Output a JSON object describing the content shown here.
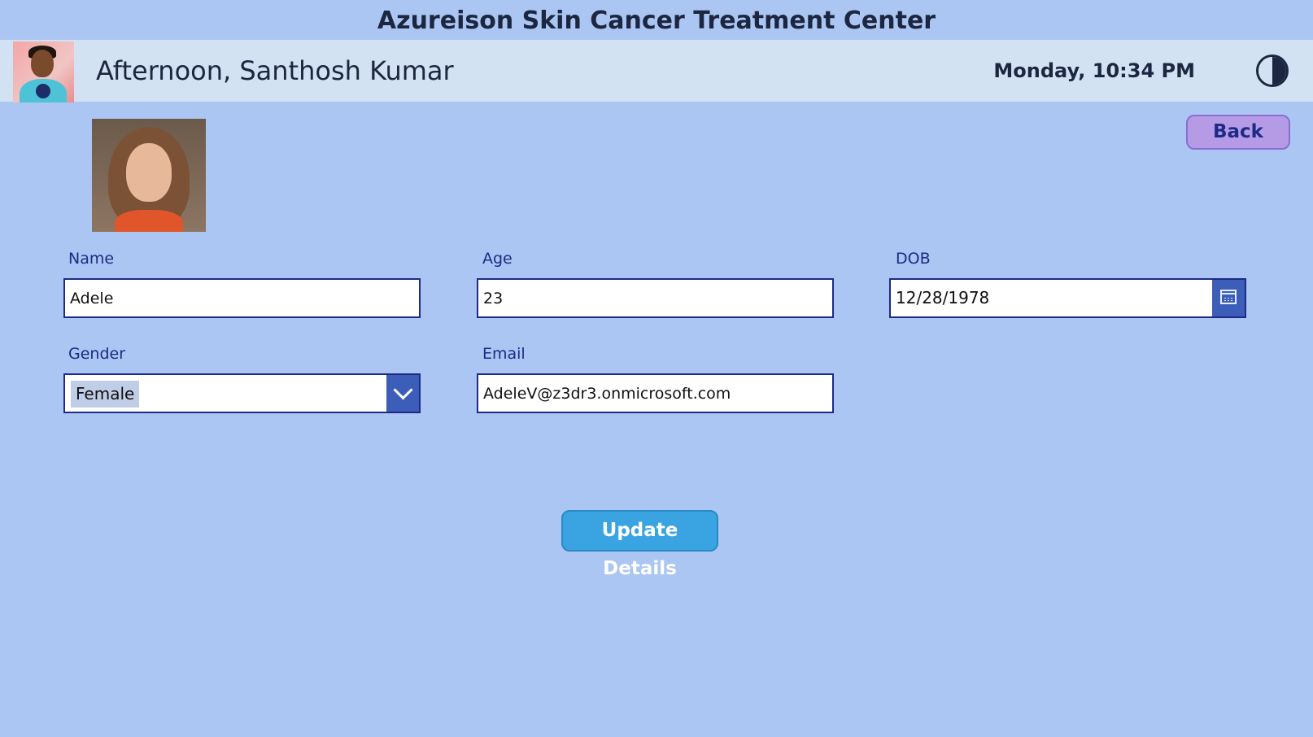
{
  "app": {
    "title": "Azureison Skin Cancer Treatment Center"
  },
  "header": {
    "greeting": "Afternoon, Santhosh Kumar",
    "datetime": "Monday, 10:34 PM",
    "theme_icon": "contrast-icon"
  },
  "actions": {
    "back_label": "Back",
    "update_label": "Update Details"
  },
  "form": {
    "name": {
      "label": "Name",
      "value": "Adele"
    },
    "age": {
      "label": "Age",
      "value": "23"
    },
    "dob": {
      "label": "DOB",
      "value": "12/28/1978",
      "icon": "calendar-icon"
    },
    "gender": {
      "label": "Gender",
      "value": "Female",
      "icon": "chevron-down-icon"
    },
    "email": {
      "label": "Email",
      "value": "AdeleV@z3dr3.onmicrosoft.com"
    }
  },
  "colors": {
    "background": "#abc6f2",
    "header_bar": "#d3e2f3",
    "accent_blue": "#3c5eb8",
    "back_button": "#b59ae6",
    "update_button": "#3aa3e2",
    "text_dark": "#1c2640",
    "label_blue": "#1d2a86"
  }
}
